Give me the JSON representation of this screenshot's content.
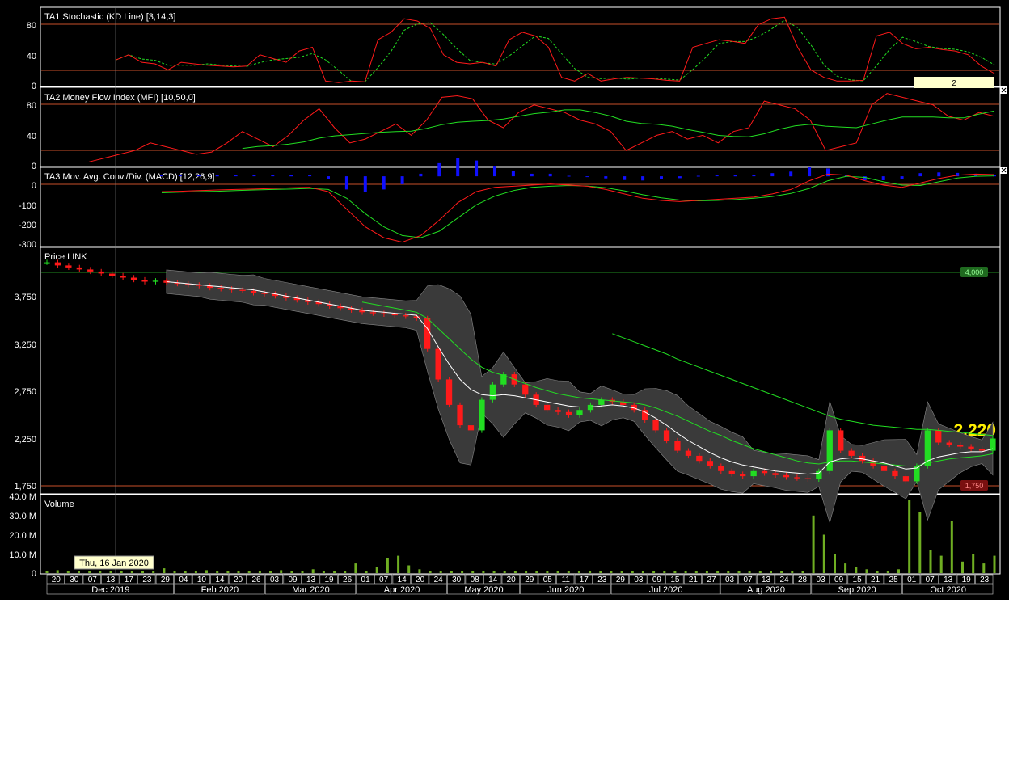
{
  "colors": {
    "background": "#000000",
    "frame": "#ffffff",
    "ref_line": "#c8502a",
    "red": "#ff1a1a",
    "green": "#22dd22",
    "blue": "#1010ff",
    "volume": "#6fae22",
    "band_fill": "#3a3a3a",
    "last_price": "#ffee00",
    "tooltip_bg": "#ffffcc"
  },
  "panels": {
    "stoch": {
      "title": "TA1 Stochastic (KD Line) [3,14,3]",
      "ticks": [
        "80",
        "40",
        "0"
      ],
      "badge": "2"
    },
    "mfi": {
      "title": "TA2 Money Flow Index (MFI) [10,50,0]",
      "ticks": [
        "80",
        "40",
        "0"
      ]
    },
    "macd": {
      "title": "TA3 Mov. Avg. Conv./Div. (MACD) [12,26,9]",
      "ticks": [
        "0",
        "-100",
        "-200",
        "-300"
      ]
    },
    "price": {
      "title": "Price LINK",
      "ticks": [
        "3,750",
        "3,250",
        "2,750",
        "2,250",
        "1,750"
      ],
      "tag_high": "4,000",
      "tag_low": "1,750",
      "last": "2.220"
    },
    "volume": {
      "title": "Volume",
      "ticks": [
        "40.0 M",
        "30.0 M",
        "20.0 M",
        "10.0 M",
        "0"
      ]
    }
  },
  "tooltip": "Thu, 16 Jan 2020",
  "x_axis": {
    "days": [
      "20",
      "30",
      "07",
      "13",
      "17",
      "23",
      "29",
      "04",
      "10",
      "14",
      "20",
      "26",
      "03",
      "09",
      "13",
      "19",
      "26",
      "01",
      "07",
      "14",
      "20",
      "24",
      "30",
      "08",
      "14",
      "20",
      "29",
      "05",
      "11",
      "17",
      "23",
      "29",
      "03",
      "09",
      "15",
      "21",
      "27",
      "03",
      "07",
      "13",
      "24",
      "28",
      "03",
      "09",
      "15",
      "21",
      "25",
      "01",
      "07",
      "13",
      "19",
      "23"
    ],
    "months": [
      "Dec 2019",
      "Feb 2020",
      "Mar 2020",
      "Apr 2020",
      "May 2020",
      "Jun 2020",
      "Jul 2020",
      "Aug 2020",
      "Sep 2020",
      "Oct 2020"
    ]
  },
  "chart_data": {
    "type": "candlestick",
    "instrument": "LINK",
    "x_range": [
      "Dec 2019",
      "Oct 2020"
    ],
    "price": {
      "ylim": [
        1700,
        4050
      ],
      "reference_lines": [
        4000,
        1750
      ],
      "last_close": 2220,
      "close": [
        3950,
        3920,
        3900,
        3880,
        3860,
        3840,
        3820,
        3800,
        3780,
        3760,
        3770,
        3750,
        3740,
        3730,
        3720,
        3700,
        3690,
        3680,
        3670,
        3650,
        3640,
        3620,
        3600,
        3580,
        3560,
        3540,
        3520,
        3500,
        3480,
        3460,
        3450,
        3440,
        3430,
        3420,
        3400,
        3100,
        2800,
        2550,
        2350,
        2300,
        2600,
        2750,
        2850,
        2750,
        2650,
        2550,
        2500,
        2480,
        2450,
        2500,
        2550,
        2600,
        2580,
        2550,
        2500,
        2400,
        2300,
        2200,
        2100,
        2050,
        2000,
        1950,
        1900,
        1870,
        1850,
        1900,
        1880,
        1860,
        1840,
        1830,
        1820,
        1900,
        2300,
        2100,
        2050,
        2000,
        1950,
        1900,
        1850,
        1800,
        1950,
        2300,
        2180,
        2160,
        2140,
        2120,
        2100,
        2220
      ],
      "ma_short": [
        null,
        null,
        null,
        null,
        null,
        null,
        null,
        null,
        null,
        null,
        null,
        3760,
        3750,
        3740,
        3730,
        3720,
        3710,
        3700,
        3690,
        3680,
        3660,
        3640,
        3620,
        3600,
        3580,
        3560,
        3540,
        3520,
        3500,
        3480,
        3470,
        3460,
        3450,
        3440,
        3430,
        3300,
        3120,
        2950,
        2800,
        2700,
        2650,
        2640,
        2650,
        2640,
        2620,
        2600,
        2580,
        2560,
        2540,
        2530,
        2530,
        2540,
        2550,
        2540,
        2520,
        2480,
        2420,
        2350,
        2270,
        2200,
        2140,
        2080,
        2030,
        1990,
        1960,
        1940,
        1920,
        1900,
        1890,
        1880,
        1870,
        1880,
        1990,
        2020,
        2030,
        2020,
        2000,
        1980,
        1950,
        1920,
        1930,
        2000,
        2040,
        2060,
        2080,
        2090,
        2090,
        2120
      ],
      "ma_mid": [
        null,
        null,
        null,
        null,
        null,
        null,
        null,
        null,
        null,
        null,
        null,
        null,
        null,
        null,
        null,
        null,
        null,
        null,
        null,
        null,
        null,
        null,
        null,
        null,
        null,
        null,
        null,
        null,
        null,
        3560,
        3540,
        3520,
        3500,
        3480,
        3460,
        3400,
        3300,
        3200,
        3100,
        3000,
        2920,
        2870,
        2840,
        2800,
        2760,
        2720,
        2690,
        2660,
        2640,
        2620,
        2610,
        2600,
        2590,
        2580,
        2570,
        2550,
        2520,
        2480,
        2440,
        2390,
        2340,
        2290,
        2250,
        2200,
        2160,
        2120,
        2090,
        2060,
        2030,
        2000,
        1980,
        1970,
        1990,
        2000,
        2000,
        1990,
        1980,
        1970,
        1960,
        1950,
        1950,
        1980,
        2000,
        2020,
        2030,
        2040,
        2050,
        2070
      ],
      "ma_long": [
        null,
        null,
        null,
        null,
        null,
        null,
        null,
        null,
        null,
        null,
        null,
        null,
        null,
        null,
        null,
        null,
        null,
        null,
        null,
        null,
        null,
        null,
        null,
        null,
        null,
        null,
        null,
        null,
        null,
        null,
        null,
        null,
        null,
        null,
        null,
        null,
        null,
        null,
        null,
        null,
        null,
        null,
        null,
        null,
        null,
        null,
        null,
        null,
        null,
        null,
        null,
        null,
        3250,
        3210,
        3170,
        3130,
        3090,
        3050,
        3000,
        2960,
        2920,
        2880,
        2840,
        2800,
        2760,
        2720,
        2680,
        2640,
        2600,
        2560,
        2520,
        2480,
        2440,
        2410,
        2390,
        2370,
        2350,
        2340,
        2330,
        2320,
        2310,
        2310,
        2300,
        2290,
        2280,
        2270,
        2260,
        2250
      ]
    },
    "volume": {
      "ylim": [
        0,
        40000000
      ],
      "values": [
        1,
        1.5,
        1,
        1,
        1,
        1.2,
        1,
        1,
        1.1,
        1,
        1,
        2.5,
        1,
        1,
        1,
        1.5,
        1,
        1,
        1.2,
        1,
        1,
        1,
        1.5,
        1,
        1,
        2,
        1,
        1,
        1,
        5,
        1,
        3,
        8,
        9,
        4,
        2,
        1,
        1,
        1,
        1,
        1,
        1,
        1,
        1,
        1,
        1,
        1,
        1,
        1,
        1,
        1,
        1,
        1,
        1,
        1,
        1,
        1,
        1,
        1,
        1,
        1,
        1,
        1,
        1,
        1,
        1,
        1,
        1,
        1,
        1,
        1,
        1,
        30,
        20,
        10,
        5,
        3,
        2,
        1,
        1,
        2,
        38,
        32,
        12,
        9,
        27,
        6,
        10,
        5,
        9
      ]
    },
    "stochastic": {
      "ylim": [
        0,
        100
      ],
      "k": [
        33,
        40,
        30,
        28,
        20,
        30,
        28,
        26,
        25,
        24,
        25,
        40,
        35,
        30,
        45,
        50,
        5,
        3,
        5,
        4,
        60,
        70,
        88,
        85,
        75,
        40,
        30,
        28,
        30,
        25,
        60,
        70,
        65,
        50,
        10,
        5,
        15,
        5,
        8,
        10,
        9,
        8,
        6,
        5,
        50,
        55,
        60,
        58,
        55,
        80,
        88,
        90,
        50,
        20,
        10,
        5,
        5,
        6,
        65,
        70,
        55,
        48,
        50,
        47,
        45,
        40,
        25,
        15
      ]
    },
    "mfi": {
      "ylim": [
        0,
        100
      ],
      "values": [
        5,
        10,
        15,
        20,
        30,
        25,
        20,
        15,
        18,
        30,
        45,
        35,
        25,
        40,
        60,
        75,
        50,
        30,
        35,
        45,
        55,
        40,
        60,
        90,
        92,
        88,
        60,
        50,
        70,
        80,
        75,
        70,
        60,
        55,
        45,
        20,
        30,
        40,
        45,
        35,
        40,
        30,
        45,
        50,
        85,
        80,
        75,
        60,
        20,
        25,
        30,
        80,
        95,
        90,
        85,
        80,
        65,
        60,
        70,
        65
      ]
    },
    "macd": {
      "ylim": [
        -320,
        30
      ],
      "macd": [
        -70,
        -68,
        -65,
        -62,
        -60,
        -58,
        -55,
        -52,
        -50,
        -70,
        -150,
        -230,
        -280,
        -300,
        -270,
        -200,
        -120,
        -70,
        -50,
        -45,
        -40,
        -35,
        -40,
        -45,
        -60,
        -80,
        -100,
        -110,
        -115,
        -110,
        -105,
        -100,
        -95,
        -80,
        -60,
        -20,
        10,
        5,
        -20,
        -40,
        -50,
        -30,
        -10,
        5,
        10,
        8
      ],
      "signal": [
        -75,
        -72,
        -70,
        -68,
        -65,
        -62,
        -60,
        -58,
        -55,
        -60,
        -100,
        -170,
        -230,
        -270,
        -280,
        -250,
        -190,
        -130,
        -90,
        -65,
        -50,
        -45,
        -42,
        -44,
        -52,
        -66,
        -84,
        -98,
        -108,
        -112,
        -110,
        -106,
        -100,
        -92,
        -78,
        -55,
        -20,
        0,
        -5,
        -25,
        -40,
        -42,
        -25,
        -8,
        0,
        2
      ]
    }
  }
}
